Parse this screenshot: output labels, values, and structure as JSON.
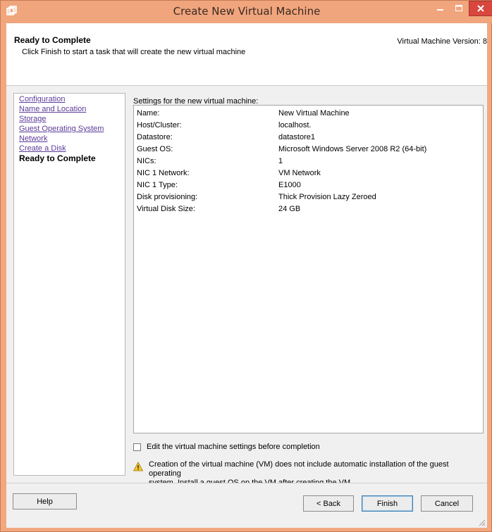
{
  "window": {
    "title": "Create New Virtual Machine",
    "titlebar_color": "#f0a57d",
    "close_color": "#d9463e"
  },
  "header": {
    "title": "Ready to Complete",
    "subtitle": "Click Finish to start a task that will create the new virtual machine",
    "version": "Virtual Machine Version: 8"
  },
  "nav": {
    "items": [
      {
        "label": "Configuration"
      },
      {
        "label": "Name and Location"
      },
      {
        "label": "Storage"
      },
      {
        "label": "Guest Operating System"
      },
      {
        "label": "Network"
      },
      {
        "label": "Create a Disk"
      },
      {
        "label": "Ready to Complete"
      }
    ],
    "link_color": "#5d3b9a"
  },
  "settings": {
    "label": "Settings for the new virtual machine:",
    "rows": [
      {
        "key": "Name:",
        "value": "New Virtual Machine"
      },
      {
        "key": "Host/Cluster:",
        "value": "localhost."
      },
      {
        "key": "Datastore:",
        "value": "datastore1"
      },
      {
        "key": "Guest OS:",
        "value": "Microsoft Windows Server 2008 R2 (64-bit)"
      },
      {
        "key": "NICs:",
        "value": "1"
      },
      {
        "key": "NIC 1 Network:",
        "value": "VM Network"
      },
      {
        "key": "NIC 1 Type:",
        "value": "E1000"
      },
      {
        "key": "Disk provisioning:",
        "value": "Thick Provision Lazy Zeroed"
      },
      {
        "key": "Virtual Disk Size:",
        "value": "24 GB"
      }
    ]
  },
  "options": {
    "edit_before_completion": "Edit the virtual machine settings before completion",
    "edit_checked": false
  },
  "warning": {
    "icon": "warning-icon",
    "line1": "Creation of the virtual machine (VM) does not include automatic installation of the guest operating",
    "line2": "system. Install a guest OS on the VM after creating the VM."
  },
  "buttons": {
    "help": "Help",
    "back": "< Back",
    "finish": "Finish",
    "cancel": "Cancel"
  }
}
